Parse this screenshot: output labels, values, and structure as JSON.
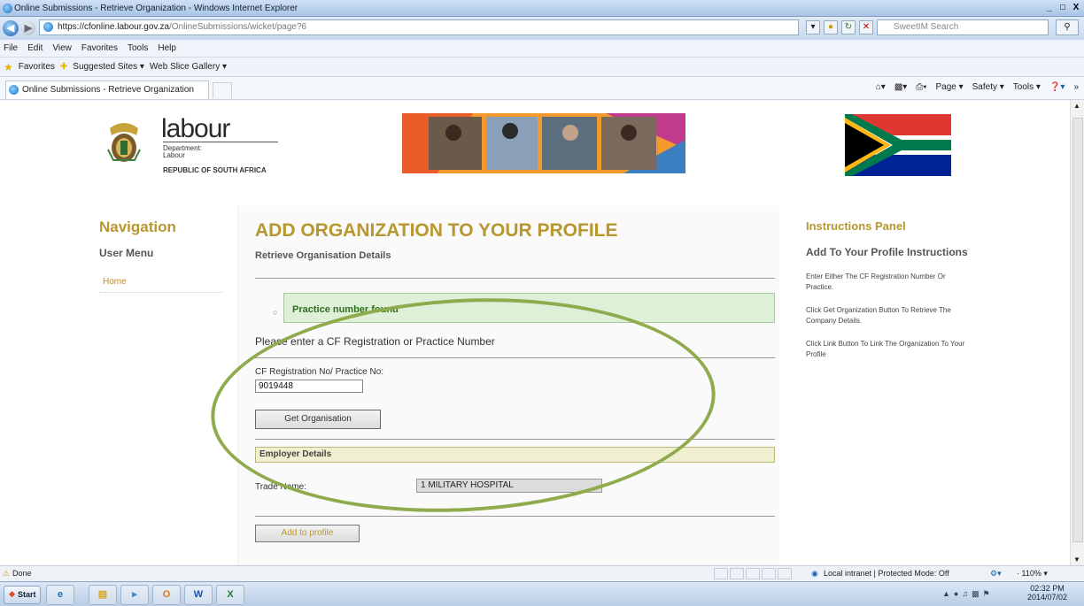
{
  "window": {
    "title": "Online Submissions - Retrieve Organization - Windows Internet Explorer",
    "controls": [
      "_",
      "□",
      "X"
    ]
  },
  "browser": {
    "url_main": "https://cfonline.labour.gov.za",
    "url_path": "/OnlineSubmissions/wicket/page?6",
    "search_placeholder": "SweetIM Search",
    "menu": [
      "File",
      "Edit",
      "View",
      "Favorites",
      "Tools",
      "Help"
    ],
    "favorites": {
      "label": "Favorites",
      "items": [
        "Suggested Sites ▾",
        "Web Slice Gallery ▾"
      ]
    },
    "tab_label": "Online Submissions - Retrieve Organization",
    "commands": [
      "Page ▾",
      "Safety ▾",
      "Tools ▾",
      "»"
    ]
  },
  "header": {
    "logo_word": "labour",
    "logo_dept": [
      "Department:",
      "Labour"
    ],
    "logo_country": "REPUBLIC OF SOUTH AFRICA",
    "flag_colors": {
      "red": "#de3831",
      "blue": "#002395",
      "green": "#007a4d",
      "black": "#000000",
      "gold": "#ffb612",
      "white": "#ffffff"
    }
  },
  "nav": {
    "title": "Navigation",
    "user_menu": "User Menu",
    "home": "Home"
  },
  "main": {
    "title": "ADD ORGANIZATION TO YOUR PROFILE",
    "subtitle": "Retrieve Organisation Details",
    "message": "Practice number found",
    "prompt": "Please enter a CF Registration or Practice Number",
    "cf_label": "CF Registration No/ Practice No:",
    "cf_value": "9019448",
    "get_button": "Get Organisation",
    "employer_header": "Employer Details",
    "trade_label": "Trade Name:",
    "trade_value": "1 MILITARY HOSPITAL",
    "add_button": "Add to profile"
  },
  "instructions": {
    "title": "Instructions Panel",
    "subtitle": "Add To Your Profile Instructions",
    "items": [
      "Enter Either The CF Registration Number Or Practice.",
      "Click Get Organization Button To Retrieve The Company Details.",
      "Click Link Button To Link The Organization To Your Profile"
    ]
  },
  "status": {
    "left": "Done",
    "zone": "Local intranet | Protected Mode: Off",
    "zoom": "· 110% ▾"
  },
  "taskbar": {
    "start": "Start",
    "time": "02:32 PM",
    "date": "2014/07/02",
    "apps": [
      "e",
      "▤",
      "▸",
      "O",
      "W",
      "X"
    ]
  },
  "colors": {
    "accent_gold": "#b8972f",
    "success_bg": "#dff0d8",
    "annotation_oval": "#8fab4d"
  }
}
